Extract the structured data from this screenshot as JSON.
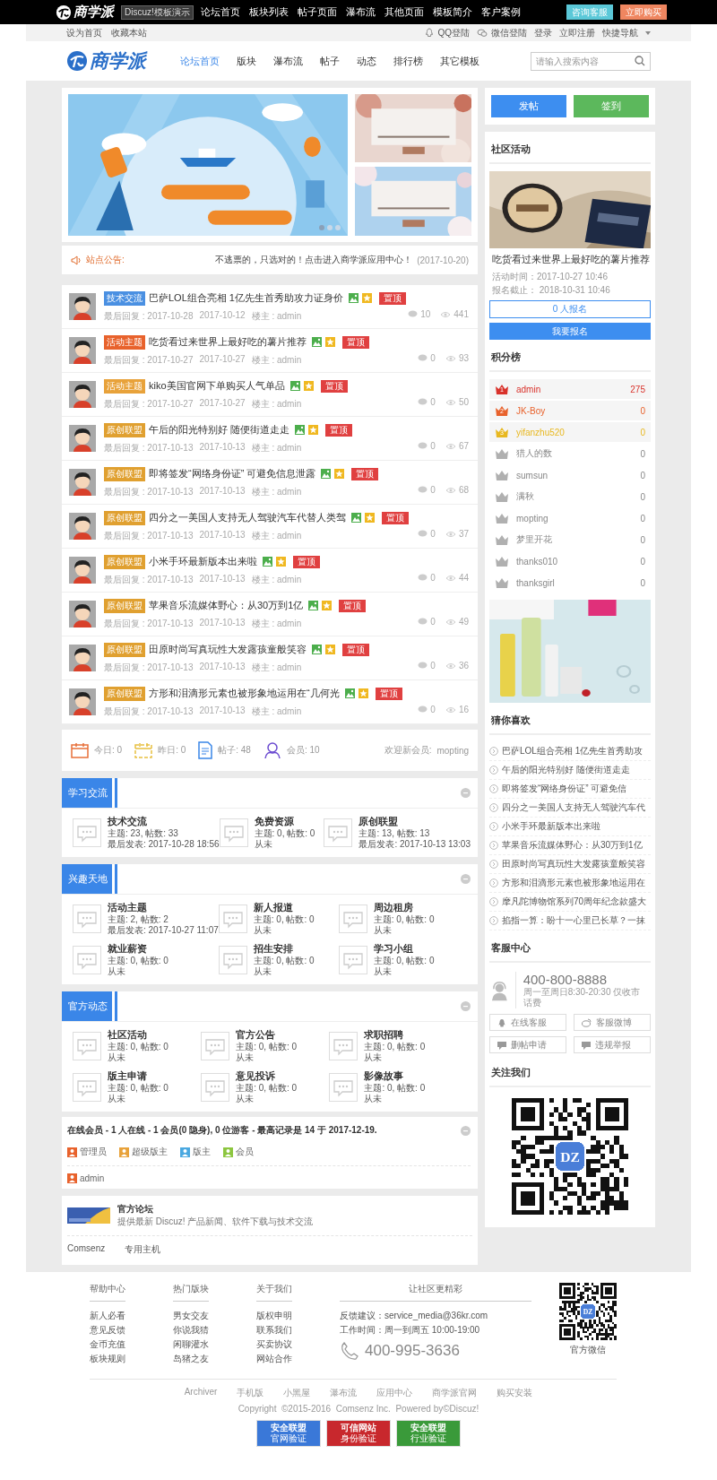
{
  "topbar": {
    "logo": "商学派",
    "demo_badge": "Discuz!模板演示",
    "nav": [
      "论坛首页",
      "板块列表",
      "帖子页面",
      "瀑布流",
      "其他页面",
      "模板简介",
      "客户案例"
    ],
    "buttons": [
      {
        "label": "咨询客服",
        "color": "#5bc8d8"
      },
      {
        "label": "立即购买",
        "color": "#ef8660"
      }
    ]
  },
  "subbar": {
    "left": [
      "设为首页",
      "收藏本站"
    ],
    "right": [
      {
        "label": "QQ登陆",
        "kind": "qq"
      },
      {
        "label": "微信登陆",
        "kind": "wechat"
      },
      {
        "label": "登录",
        "kind": "text"
      },
      {
        "label": "立即注册",
        "kind": "text"
      },
      {
        "label": "快捷导航",
        "kind": "menu"
      }
    ]
  },
  "header": {
    "logo": "商学派",
    "nav": [
      {
        "label": "论坛首页",
        "selected": true
      },
      {
        "label": "版块",
        "selected": false
      },
      {
        "label": "瀑布流",
        "selected": false
      },
      {
        "label": "帖子",
        "selected": false
      },
      {
        "label": "动态",
        "selected": false
      },
      {
        "label": "排行榜",
        "selected": false
      },
      {
        "label": "其它模板",
        "selected": false
      }
    ],
    "search": {
      "placeholder": "请输入搜索内容"
    }
  },
  "banner": {
    "slides": [
      {
        "selected": true
      },
      {
        "selected": false
      },
      {
        "selected": false
      }
    ]
  },
  "notice": {
    "label": "站点公告:",
    "text": "不逃票的，只选对的！点击进入商学派应用中心！",
    "date": "(2017-10-20)"
  },
  "posts": [
    {
      "tag": "技术交流",
      "color": "#4a90e2",
      "title": "巴萨LOL组合亮相 1亿先生首秀助攻力证身价",
      "badge": "置顶",
      "last_reply": "最后回复 : 2017-10-28",
      "date": "2017-10-12",
      "author": "楼主 : admin",
      "replies": "10",
      "views": "441"
    },
    {
      "tag": "活动主题",
      "color": "#e8622c",
      "title": "吃货看过来世界上最好吃的薯片推荐",
      "badge": "置顶",
      "last_reply": "最后回复 : 2017-10-27",
      "date": "2017-10-27",
      "author": "楼主 : admin",
      "replies": "0",
      "views": "93"
    },
    {
      "tag": "活动主题",
      "color": "#e8a23a",
      "title": "kiko美国官网下单购买人气单品",
      "badge": "置顶",
      "last_reply": "最后回复 : 2017-10-27",
      "date": "2017-10-27",
      "author": "楼主 : admin",
      "replies": "0",
      "views": "50"
    },
    {
      "tag": "原创联盟",
      "color": "#e0a030",
      "title": "午后的阳光特别好 随便街道走走",
      "badge": "置顶",
      "last_reply": "最后回复 : 2017-10-13",
      "date": "2017-10-13",
      "author": "楼主 : admin",
      "replies": "0",
      "views": "67"
    },
    {
      "tag": "原创联盟",
      "color": "#e0a030",
      "title": "即将签发“网络身份证” 可避免信息泄露",
      "badge": "置顶",
      "last_reply": "最后回复 : 2017-10-13",
      "date": "2017-10-13",
      "author": "楼主 : admin",
      "replies": "0",
      "views": "68"
    },
    {
      "tag": "原创联盟",
      "color": "#e0a030",
      "title": "四分之一美国人支持无人驾驶汽车代替人类驾",
      "badge": "置顶",
      "last_reply": "最后回复 : 2017-10-13",
      "date": "2017-10-13",
      "author": "楼主 : admin",
      "replies": "0",
      "views": "37"
    },
    {
      "tag": "原创联盟",
      "color": "#e0a030",
      "title": "小米手环最新版本出来啦",
      "badge": "置顶",
      "last_reply": "最后回复 : 2017-10-13",
      "date": "2017-10-13",
      "author": "楼主 : admin",
      "replies": "0",
      "views": "44"
    },
    {
      "tag": "原创联盟",
      "color": "#e0a030",
      "title": "苹果音乐流媒体野心：从30万到1亿",
      "badge": "置顶",
      "last_reply": "最后回复 : 2017-10-13",
      "date": "2017-10-13",
      "author": "楼主 : admin",
      "replies": "0",
      "views": "49"
    },
    {
      "tag": "原创联盟",
      "color": "#e0a030",
      "title": "田原时尚写真玩性大发露孩童般笑容",
      "badge": "置顶",
      "last_reply": "最后回复 : 2017-10-13",
      "date": "2017-10-13",
      "author": "楼主 : admin",
      "replies": "0",
      "views": "36"
    },
    {
      "tag": "原创联盟",
      "color": "#e0a030",
      "title": "方形和泪滴形元素也被形象地运用在“几何光",
      "badge": "置顶",
      "last_reply": "最后回复 : 2017-10-13",
      "date": "2017-10-13",
      "author": "楼主 : admin",
      "replies": "0",
      "views": "16"
    }
  ],
  "stats": {
    "items": [
      {
        "kind": "today",
        "label": "今日: 0"
      },
      {
        "kind": "yesterday",
        "label": "昨日: 0"
      },
      {
        "kind": "posts",
        "label": "帖子: 48"
      },
      {
        "kind": "members",
        "label": "会员: 10"
      }
    ],
    "welcome_label": "欢迎新会员:",
    "newest_member": "mopting"
  },
  "sections": [
    {
      "title": "学习交流",
      "forums": [
        {
          "name": "技术交流",
          "counts": "主题: 23, 帖数: 33",
          "last": "最后发表: 2017-10-28 18:56"
        },
        {
          "name": "免费资源",
          "counts": "主题: 0, 帖数: 0",
          "last": "从未"
        },
        {
          "name": "原创联盟",
          "counts": "主题: 13, 帖数: 13",
          "last": "最后发表: 2017-10-13 13:03"
        }
      ]
    },
    {
      "title": "兴趣天地",
      "forums": [
        {
          "name": "活动主题",
          "counts": "主题: 2, 帖数: 2",
          "last": "最后发表: 2017-10-27 11:07"
        },
        {
          "name": "新人报道",
          "counts": "主题: 0, 帖数: 0",
          "last": "从未"
        },
        {
          "name": "周边租房",
          "counts": "主题: 0, 帖数: 0",
          "last": "从未"
        },
        {
          "name": "就业薪资",
          "counts": "主题: 0, 帖数: 0",
          "last": "从未"
        },
        {
          "name": "招生安排",
          "counts": "主题: 0, 帖数: 0",
          "last": "从未"
        },
        {
          "name": "学习小组",
          "counts": "主题: 0, 帖数: 0",
          "last": "从未"
        }
      ]
    },
    {
      "title": "官方动态",
      "forums": [
        {
          "name": "社区活动",
          "counts": "主题: 0, 帖数: 0",
          "last": "从未"
        },
        {
          "name": "官方公告",
          "counts": "主题: 0, 帖数: 0",
          "last": "从未"
        },
        {
          "name": "求职招聘",
          "counts": "主题: 0, 帖数: 0",
          "last": "从未"
        },
        {
          "name": "版主申请",
          "counts": "主题: 0, 帖数: 0",
          "last": "从未"
        },
        {
          "name": "意见投诉",
          "counts": "主题: 0, 帖数: 0",
          "last": "从未"
        },
        {
          "name": "影像故事",
          "counts": "主题: 0, 帖数: 0",
          "last": "从未"
        }
      ]
    }
  ],
  "online": {
    "summary": "在线会员 - 1 人在线 - 1 会员(0 隐身), 0 位游客 - 最高记录是 14 于 2017-12-19.",
    "legend": [
      {
        "label": "管理员",
        "color": "#e8622c"
      },
      {
        "label": "超级版主",
        "color": "#e8a23a"
      },
      {
        "label": "版主",
        "color": "#4aa8e0"
      },
      {
        "label": "会员",
        "color": "#8cc63f"
      }
    ],
    "users": [
      {
        "name": "admin",
        "color": "#e8622c"
      }
    ]
  },
  "links": {
    "featured": {
      "name": "官方论坛",
      "desc": "提供最新 Discuz! 产品新闻、软件下载与技术交流"
    },
    "text_links": [
      "Comsenz",
      "专用主机"
    ]
  },
  "sidebar": {
    "actions": [
      {
        "label": "发帖",
        "color": "#3d8ef0"
      },
      {
        "label": "签到",
        "color": "#5cb85c"
      }
    ],
    "activity": {
      "title": "社区活动",
      "name": "吃货看过来世界上最好吃的薯片推荐",
      "time": "活动时间：2017-10-27 10:46",
      "deadline": "报名截止： 2018-10-31 10:46",
      "signed_up": "0 人报名",
      "join": "我要报名"
    },
    "ranking": {
      "title": "积分榜",
      "items": [
        {
          "rank": "1",
          "name": "admin",
          "score": "275",
          "color": "#d9322b"
        },
        {
          "rank": "2",
          "name": "JK-Boy",
          "score": "0",
          "color": "#e8622c"
        },
        {
          "rank": "3",
          "name": "yifanzhu520",
          "score": "0",
          "color": "#e8b820"
        },
        {
          "name": "猎人的数",
          "score": "0",
          "color": "#b0b0b0"
        },
        {
          "name": "sumsun",
          "score": "0",
          "color": "#b0b0b0"
        },
        {
          "name": "满秋",
          "score": "0",
          "color": "#b0b0b0"
        },
        {
          "name": "mopting",
          "score": "0",
          "color": "#b0b0b0"
        },
        {
          "name": "梦里开花",
          "score": "0",
          "color": "#b0b0b0"
        },
        {
          "name": "thanks010",
          "score": "0",
          "color": "#b0b0b0"
        },
        {
          "name": "thanksgirl",
          "score": "0",
          "color": "#b0b0b0"
        }
      ]
    },
    "guess": {
      "title": "猜你喜欢",
      "items": [
        "巴萨LOL组合亮相 1亿先生首秀助攻",
        "午后的阳光特别好 随便街道走走",
        "即将签发“网络身份证” 可避免信",
        "四分之一美国人支持无人驾驶汽车代",
        "小米手环最新版本出来啦",
        "苹果音乐流媒体野心：从30万到1亿",
        "田原时尚写真玩性大发露孩童般笑容",
        "方形和泪滴形元素也被形象地运用在",
        "摩凡陀博物馆系列70周年纪念款盛大",
        "掐指一算：盼十一心里已长草？一抹"
      ]
    },
    "service": {
      "title": "客服中心",
      "phone": "400-800-8888",
      "hours": "周一至周日8:30-20:30 仅收市话费",
      "buttons": [
        {
          "label": "在线客服",
          "kind": "chat"
        },
        {
          "label": "客服微博",
          "kind": "weibo"
        },
        {
          "label": "删帖申请",
          "kind": "message"
        },
        {
          "label": "违规举报",
          "kind": "message"
        }
      ]
    },
    "follow": {
      "title": "关注我们",
      "qr_logo": "DZ"
    }
  },
  "footer": {
    "columns": [
      {
        "title": "帮助中心",
        "links": [
          "新人必看",
          "意见反馈",
          "金币充值",
          "板块规则"
        ]
      },
      {
        "title": "热门版块",
        "links": [
          "男女交友",
          "你说我猜",
          "闲聊灌水",
          "岛猪之友"
        ]
      },
      {
        "title": "关于我们",
        "links": [
          "版权申明",
          "联系我们",
          "买卖协议",
          "网站合作"
        ]
      }
    ],
    "contact": {
      "title": "让社区更精彩",
      "lines": [
        "反馈建议：service_media@36kr.com",
        "工作时间：周一到周五 10:00-19:00"
      ],
      "phone": "400-995-3636"
    },
    "qr": {
      "logo": "DZ",
      "caption": "官方微信"
    },
    "links": [
      "Archiver",
      "手机版",
      "小黑屋",
      "瀑布流",
      "应用中心",
      "商学派官网",
      "购买安装"
    ],
    "copyright": "Copyright  ©2015-2016  Comsenz Inc.  Powered by©Discuz!",
    "badges": [
      {
        "title": "安全联盟",
        "subtitle": "官网验证",
        "color": "#3a78d8"
      },
      {
        "title": "可信网站",
        "subtitle": "身份验证",
        "color": "#c8282d"
      },
      {
        "title": "安全联盟",
        "subtitle": "行业验证",
        "color": "#3a9a3a"
      }
    ]
  }
}
